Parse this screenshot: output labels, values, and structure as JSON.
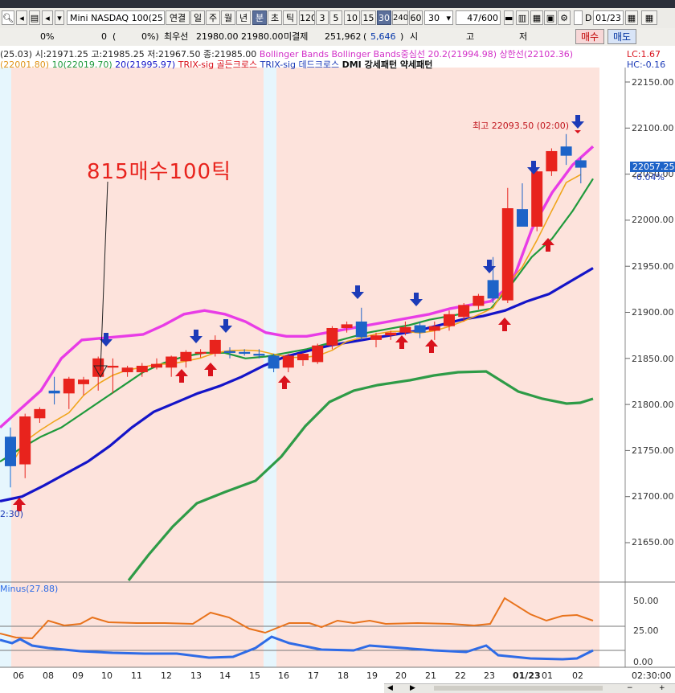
{
  "toolbar": {
    "symbol_label": "Mini NASDAQ 100(25.0",
    "link_label": "연결",
    "periods": [
      "일",
      "주",
      "월",
      "년",
      "분",
      "초",
      "틱"
    ],
    "intervals": [
      "120",
      "3",
      "5",
      "10",
      "15",
      "30",
      "240",
      "60"
    ],
    "active_period": "분",
    "active_interval": "30",
    "interval_select": "30",
    "count_value": "47",
    "count_total": "/600",
    "date_value": "01/23",
    "checkbox_d": "D"
  },
  "quote_bar": {
    "pct1": "0%",
    "val2": "0",
    "paren_open": "(",
    "pct2": "0%)",
    "best_label": "최우선",
    "best_bid": "21980.00",
    "best_ask": "21980.00",
    "oi_label": "미결제",
    "oi_value": "251,962",
    "oi_change_open": "(",
    "oi_change": "5,646",
    "oi_change_close": ")",
    "c1": "시",
    "c2": "고",
    "c3": "저",
    "buy_button": "매수",
    "sell_button": "매도"
  },
  "legend": {
    "ohlc": "(25.03) 시:21971.25 고:21985.25 저:21967.50 종:21985.00",
    "bb": "Bollinger Bands",
    "bb_mid": "Bollinger Bands중심선 20.2(21994.98)",
    "bb_upper": "상한선(22102.36)",
    "lc": "LC:1.67",
    "ma5": "(22001.80)",
    "ma10": "10(22019.70)",
    "ma20": "20(21995.97)",
    "trix_golden": "TRIX-sig 골든크로스",
    "trix_dead": "TRIX-sig 데드크로스",
    "dmi": "DMI 강세패턴 약세패턴",
    "hc": "HC:-0.16"
  },
  "colors": {
    "bg_session": "#fde3dc",
    "bg_off": "#e6f6fd",
    "up": "#e8231d",
    "down": "#1d63c8",
    "bb": "#e83ce6",
    "ma5": "#f0a51c",
    "ma10": "#1f9a3c",
    "ma20": "#1414c8",
    "ma_long": "#2e9b47",
    "buy_arrow": "#d9121c",
    "sell_arrow": "#1c3bb8",
    "dmi_plus": "#e8731c",
    "dmi_minus": "#2e6be6"
  },
  "annotation": {
    "note": "815매수100틱",
    "high_label": "최고 22093.50 (02:00)",
    "left_time": "2:30)"
  },
  "price_axis": {
    "labels": [
      "22150.00",
      "22100.00",
      "22050.00",
      "22000.00",
      "21950.00",
      "21900.00",
      "21850.00",
      "21800.00",
      "21750.00",
      "21700.00",
      "21650.00"
    ],
    "current_price": "22057.25",
    "current_change": "-0.04%"
  },
  "x_axis": {
    "labels": [
      "06",
      "08",
      "09",
      "10",
      "11",
      "12",
      "13",
      "14",
      "15",
      "16",
      "17",
      "18",
      "19",
      "20",
      "21",
      "22",
      "23",
      "01/23",
      "01",
      "02"
    ],
    "end_time": "02:30:00"
  },
  "sub_panel": {
    "title": "Minus(27.88)",
    "labels": [
      "50.00",
      "25.00",
      "0.00"
    ]
  },
  "chart_data": {
    "type": "candlestick",
    "timeframe_minutes": 30,
    "ylim": [
      21620,
      22170
    ],
    "candles": [
      {
        "o": 21765,
        "h": 21775,
        "l": 21710,
        "c": 21733
      },
      {
        "o": 21735,
        "h": 21790,
        "l": 21720,
        "c": 21787
      },
      {
        "o": 21785,
        "h": 21797,
        "l": 21780,
        "c": 21795
      },
      {
        "o": 21815,
        "h": 21830,
        "l": 21800,
        "c": 21812
      },
      {
        "o": 21812,
        "h": 21830,
        "l": 21795,
        "c": 21828
      },
      {
        "o": 21822,
        "h": 21830,
        "l": 21810,
        "c": 21827
      },
      {
        "o": 21830,
        "h": 21852,
        "l": 21815,
        "c": 21850
      },
      {
        "o": 21840,
        "h": 21850,
        "l": 21812,
        "c": 21842
      },
      {
        "o": 21835,
        "h": 21842,
        "l": 21830,
        "c": 21840
      },
      {
        "o": 21835,
        "h": 21845,
        "l": 21830,
        "c": 21842
      },
      {
        "o": 21840,
        "h": 21850,
        "l": 21838,
        "c": 21844
      },
      {
        "o": 21840,
        "h": 21853,
        "l": 21830,
        "c": 21852
      },
      {
        "o": 21847,
        "h": 21859,
        "l": 21840,
        "c": 21857
      },
      {
        "o": 21855,
        "h": 21860,
        "l": 21851,
        "c": 21857
      },
      {
        "o": 21855,
        "h": 21875,
        "l": 21852,
        "c": 21870
      },
      {
        "o": 21858,
        "h": 21862,
        "l": 21850,
        "c": 21856
      },
      {
        "o": 21857,
        "h": 21860,
        "l": 21853,
        "c": 21855
      },
      {
        "o": 21855,
        "h": 21860,
        "l": 21850,
        "c": 21853
      },
      {
        "o": 21853,
        "h": 21855,
        "l": 21835,
        "c": 21839
      },
      {
        "o": 21840,
        "h": 21855,
        "l": 21835,
        "c": 21853
      },
      {
        "o": 21848,
        "h": 21856,
        "l": 21842,
        "c": 21855
      },
      {
        "o": 21846,
        "h": 21866,
        "l": 21844,
        "c": 21864
      },
      {
        "o": 21864,
        "h": 21885,
        "l": 21860,
        "c": 21883
      },
      {
        "o": 21883,
        "h": 21890,
        "l": 21878,
        "c": 21887
      },
      {
        "o": 21890,
        "h": 21905,
        "l": 21870,
        "c": 21873
      },
      {
        "o": 21870,
        "h": 21878,
        "l": 21862,
        "c": 21875
      },
      {
        "o": 21875,
        "h": 21880,
        "l": 21870,
        "c": 21878
      },
      {
        "o": 21878,
        "h": 21890,
        "l": 21875,
        "c": 21884
      },
      {
        "o": 21886,
        "h": 21890,
        "l": 21872,
        "c": 21878
      },
      {
        "o": 21880,
        "h": 21890,
        "l": 21870,
        "c": 21885
      },
      {
        "o": 21885,
        "h": 21902,
        "l": 21880,
        "c": 21898
      },
      {
        "o": 21895,
        "h": 21910,
        "l": 21890,
        "c": 21908
      },
      {
        "o": 21907,
        "h": 21920,
        "l": 21903,
        "c": 21918
      },
      {
        "o": 21935,
        "h": 21960,
        "l": 21910,
        "c": 21915
      },
      {
        "o": 21913,
        "h": 22035,
        "l": 21910,
        "c": 22013
      },
      {
        "o": 22012,
        "h": 22040,
        "l": 21995,
        "c": 21993
      },
      {
        "o": 21993,
        "h": 22055,
        "l": 21988,
        "c": 22053
      },
      {
        "o": 22053,
        "h": 22078,
        "l": 22048,
        "c": 22075
      },
      {
        "o": 22080,
        "h": 22093.5,
        "l": 22060,
        "c": 22070
      },
      {
        "o": 22065,
        "h": 22068,
        "l": 22040,
        "c": 22057
      }
    ],
    "series": [
      {
        "name": "Bollinger Bands",
        "values": [
          21775,
          21795,
          21815,
          21850,
          21870,
          21872,
          21874,
          21876,
          21886,
          21898,
          21902,
          21898,
          21890,
          21878,
          21874,
          21874,
          21878,
          21882,
          21886,
          21890,
          21894,
          21898,
          21904,
          21908,
          21912,
          21930,
          21990,
          22030,
          22060,
          22080
        ]
      },
      {
        "name": "10(22019.70)",
        "values": [
          21738,
          21752,
          21765,
          21775,
          21790,
          21805,
          21820,
          21835,
          21845,
          21852,
          21856,
          21856,
          21850,
          21852,
          21856,
          21860,
          21866,
          21872,
          21878,
          21882,
          21886,
          21892,
          21896,
          21900,
          21904,
          21930,
          21960,
          21980,
          22010,
          22045
        ]
      },
      {
        "name": "20(21995.97)",
        "values": [
          21695,
          21700,
          21712,
          21725,
          21738,
          21755,
          21775,
          21792,
          21802,
          21812,
          21820,
          21830,
          21842,
          21852,
          21858,
          21864,
          21868,
          21872,
          21876,
          21880,
          21886,
          21892,
          21896,
          21902,
          21912,
          21920,
          21934,
          21948
        ]
      }
    ]
  }
}
